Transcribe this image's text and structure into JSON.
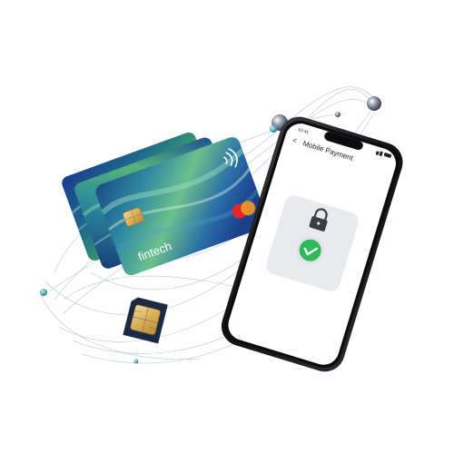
{
  "card": {
    "brand": "fintech"
  },
  "phone": {
    "status_time": "10:41",
    "back_glyph": "<",
    "screen_title": "Mobile Payment"
  },
  "icons": {
    "lock": "lock-icon",
    "check": "checkmark-icon",
    "contactless": "contactless-icon",
    "chip": "emv-chip-icon",
    "mastercard": "mastercard-logo-icon"
  },
  "colors": {
    "card_teal": "#1f6f7a",
    "card_blue": "#1e3f8f",
    "card_green": "#3ea06a",
    "success_green": "#2fb85c",
    "phone_frame": "#1a1a1c",
    "mastercard_red": "#e3262b",
    "mastercard_orange": "#f39a1e"
  }
}
